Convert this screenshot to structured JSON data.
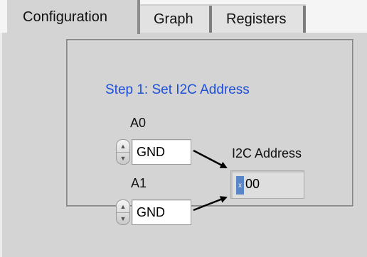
{
  "tabs": [
    {
      "label": "Configuration",
      "active": true
    },
    {
      "label": "Graph",
      "active": false
    },
    {
      "label": "Registers",
      "active": false
    }
  ],
  "step1": {
    "title": "Step 1: Set I2C Address",
    "a0": {
      "label": "A0",
      "value": "GND"
    },
    "a1": {
      "label": "A1",
      "value": "GND"
    },
    "address": {
      "label": "I2C Address",
      "radix": "x",
      "value": "00"
    }
  },
  "colors": {
    "title_blue": "#1d4fd8",
    "panel_bg": "#d4d4d4",
    "radix_blue": "#5b86c6"
  }
}
